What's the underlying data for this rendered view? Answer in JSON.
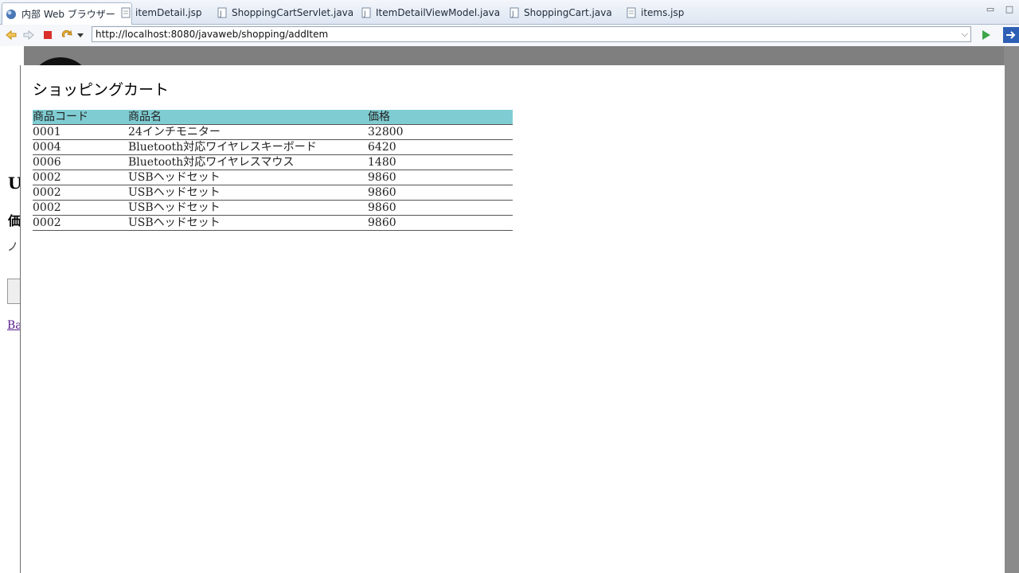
{
  "tabs": [
    {
      "label": "内部 Web ブラウザー",
      "icon": "globe-icon",
      "active": true
    },
    {
      "label": "itemDetail.jsp",
      "icon": "jsp-file-icon"
    },
    {
      "label": "ShoppingCartServlet.java",
      "icon": "java-file-icon"
    },
    {
      "label": "ItemDetailViewModel.java",
      "icon": "java-file-icon"
    },
    {
      "label": "ShoppingCart.java",
      "icon": "java-file-icon"
    },
    {
      "label": "items.jsp",
      "icon": "jsp-file-icon"
    }
  ],
  "toolbar": {
    "url": "http://localhost:8080/javaweb/shopping/addItem"
  },
  "page": {
    "title": "ショッピングカート",
    "columns": [
      "商品コード",
      "商品名",
      "価格"
    ],
    "rows": [
      {
        "code": "0001",
        "name": "24インチモニター",
        "price": "32800"
      },
      {
        "code": "0004",
        "name": "Bluetooth対応ワイヤレスキーボード",
        "price": "6420"
      },
      {
        "code": "0006",
        "name": "Bluetooth対応ワイヤレスマウス",
        "price": "1480"
      },
      {
        "code": "0002",
        "name": "USBヘッドセット",
        "price": "9860"
      },
      {
        "code": "0002",
        "name": "USBヘッドセット",
        "price": "9860"
      },
      {
        "code": "0002",
        "name": "USBヘッドセット",
        "price": "9860"
      },
      {
        "code": "0002",
        "name": "USBヘッドセット",
        "price": "9860"
      }
    ]
  },
  "behind_page": {
    "letter1": "U",
    "letter2": "価",
    "letter3": "ノ",
    "link": "Ba"
  },
  "colors": {
    "table_header": "#7fcdd3",
    "overlay": "#7f7f7f"
  }
}
